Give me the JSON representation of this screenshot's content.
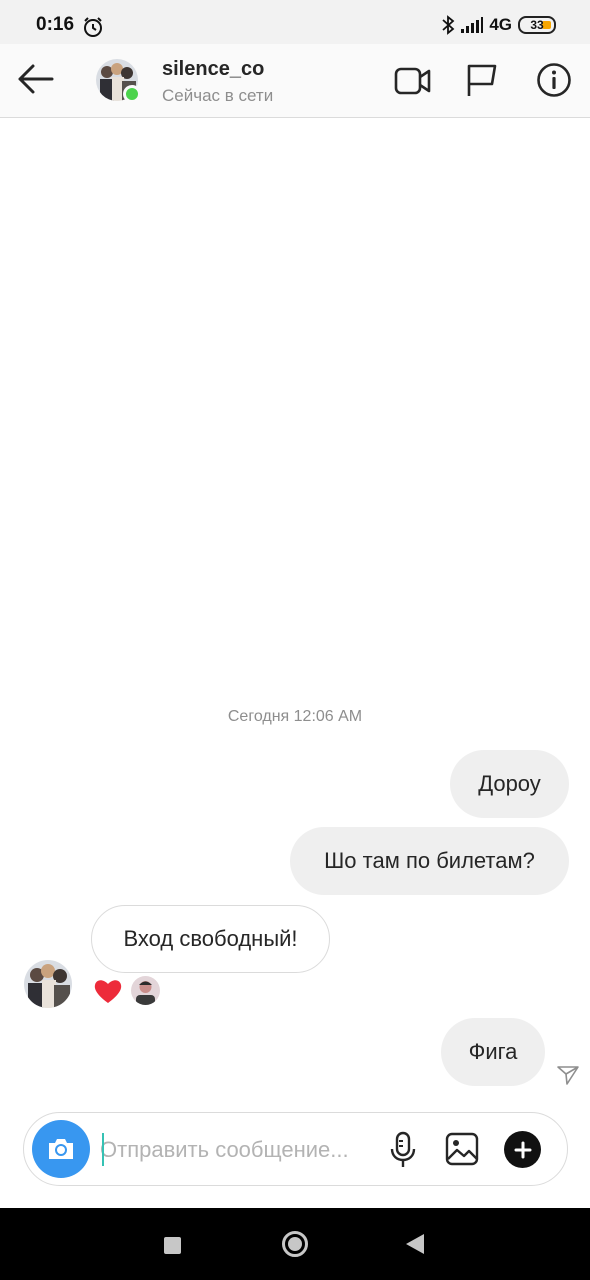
{
  "status_bar": {
    "time": "0:16",
    "network": "4G",
    "network_sub": "ıl",
    "battery": "33",
    "icons": [
      "alarm-icon",
      "bluetooth-icon",
      "signal-icon",
      "battery-icon"
    ]
  },
  "header": {
    "username": "silence_co",
    "status": "Сейчас в сети",
    "icons": [
      "back-arrow-icon",
      "video-call-icon",
      "flag-icon",
      "info-icon"
    ],
    "online_color": "#4cd34c"
  },
  "chat": {
    "date_separator": "Сегодня 12:06 AM",
    "messages": [
      {
        "direction": "outgoing",
        "text": "Дороу"
      },
      {
        "direction": "outgoing",
        "text": "Шо там по билетам?"
      },
      {
        "direction": "incoming",
        "text": "Вход свободный!",
        "reactions": [
          "heart-icon"
        ]
      },
      {
        "direction": "outgoing",
        "text": "Фига",
        "seen_icon": "send-arrow-icon"
      }
    ]
  },
  "composer": {
    "placeholder": "Отправить сообщение...",
    "value": "",
    "icons": [
      "camera-icon",
      "microphone-icon",
      "gallery-icon",
      "plus-icon"
    ],
    "camera_color": "#3897f0"
  },
  "nav_bar": {
    "icons": [
      "recent-apps-icon",
      "home-icon",
      "back-icon"
    ]
  },
  "colors": {
    "outgoing_bubble": "#efefef",
    "incoming_border": "#dbdbdb",
    "heart": "#ed2b3a"
  }
}
